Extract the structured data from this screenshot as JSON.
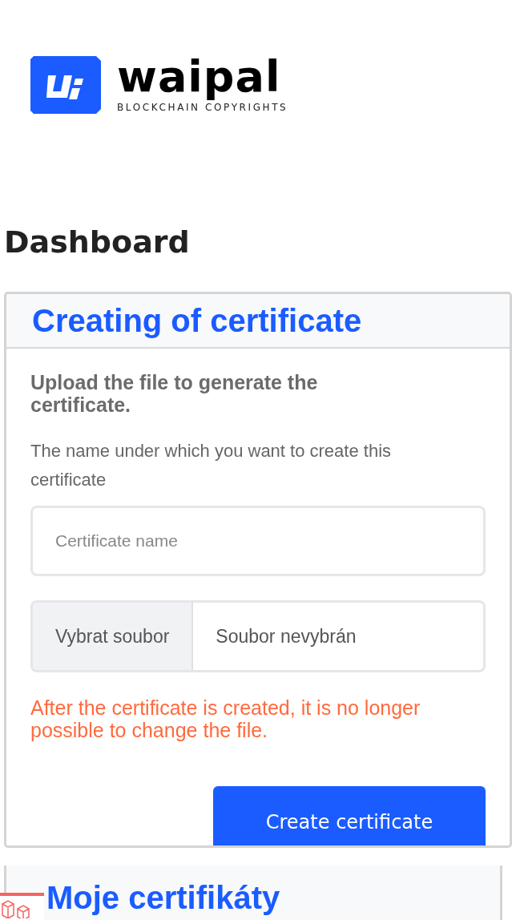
{
  "logo": {
    "name": "waipal",
    "tagline": "BLOCKCHAIN COPYRIGHTS"
  },
  "page_title": "Dashboard",
  "create_card": {
    "title": "Creating of certificate",
    "subtitle": "Upload the file to generate the certificate.",
    "name_label": "The name under which you want to create this certificate",
    "name_field": {
      "placeholder": "Certificate name"
    },
    "file_field": {
      "button": "Vybrat soubor",
      "value": "Soubor nevybrán"
    },
    "warning": "After the certificate is created, it is no longer possible to change the file.",
    "submit": "Create certificate"
  },
  "list_card": {
    "title": "Moje certifikáty"
  }
}
